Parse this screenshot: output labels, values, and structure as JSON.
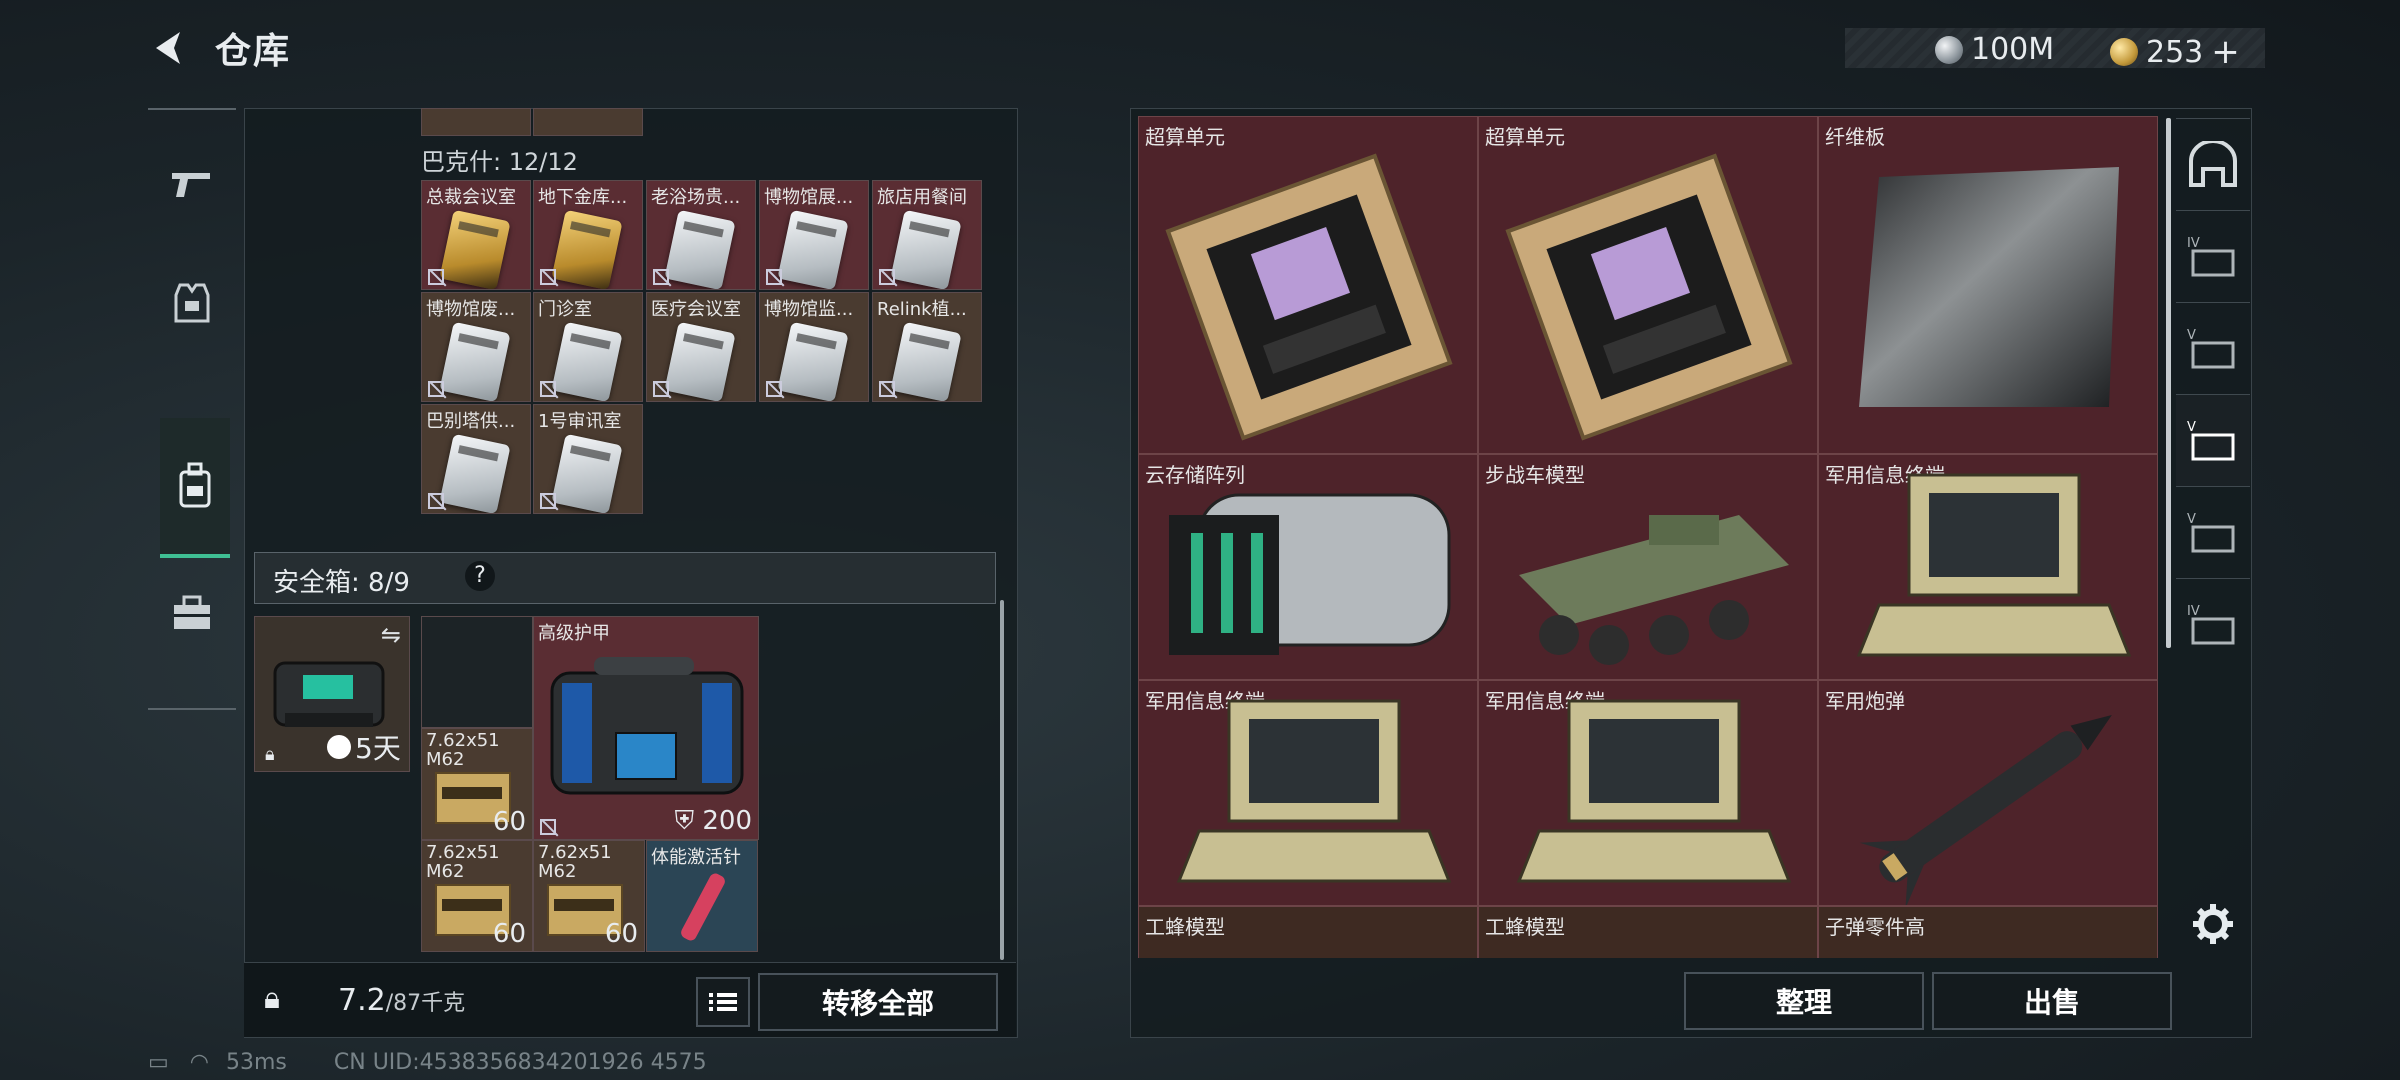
{
  "header": {
    "title": "仓库",
    "silver": "100M",
    "gold": "253",
    "gold_plus": "+"
  },
  "stash": {
    "bucket_label": "巴克什: 12/12",
    "cards": [
      {
        "label": "总裁会议室",
        "kind": "gold"
      },
      {
        "label": "地下金库...",
        "kind": "gold"
      },
      {
        "label": "老浴场贵...",
        "kind": "white"
      },
      {
        "label": "博物馆展...",
        "kind": "white"
      },
      {
        "label": "旅店用餐间",
        "kind": "white"
      },
      {
        "label": "博物馆废...",
        "kind": "white"
      },
      {
        "label": "门诊室",
        "kind": "white"
      },
      {
        "label": "医疗会议室",
        "kind": "white"
      },
      {
        "label": "博物馆监...",
        "kind": "white"
      },
      {
        "label": "Relink植...",
        "kind": "white"
      },
      {
        "label": "巴别塔供...",
        "kind": "white"
      },
      {
        "label": "1号审讯室",
        "kind": "white"
      }
    ]
  },
  "safebox": {
    "label": "安全箱: 8/9",
    "help": "?",
    "time": "5天"
  },
  "items": {
    "armor": {
      "label": "高级护甲",
      "durability": "200"
    },
    "ammo1": {
      "label": "7.62x51 M62",
      "count": "60"
    },
    "ammo2": {
      "label": "7.62x51 M62",
      "count": "60"
    },
    "ammo3": {
      "label": "7.62x51 M62",
      "count": "60"
    },
    "injector": {
      "label": "体能激活针"
    }
  },
  "bottom_left": {
    "weight": "7.2",
    "weight_max": "/87千克",
    "transfer_all": "转移全部"
  },
  "grid": [
    {
      "label": "超算单元",
      "icon": "chip"
    },
    {
      "label": "超算单元",
      "icon": "chip"
    },
    {
      "label": "纤维板",
      "icon": "plate"
    },
    {
      "label": "云存储阵列",
      "icon": "server"
    },
    {
      "label": "步战车模型",
      "icon": "ifv"
    },
    {
      "label": "军用信息终端",
      "icon": "terminal"
    },
    {
      "label": "军用信息终端",
      "icon": "terminal"
    },
    {
      "label": "军用信息终端",
      "icon": "terminal"
    },
    {
      "label": "军用炮弹",
      "icon": "missile"
    },
    {
      "label": "工蜂模型",
      "icon": "drone"
    },
    {
      "label": "工蜂模型",
      "icon": "drone"
    },
    {
      "label": "子弹零件高",
      "icon": "part"
    }
  ],
  "bottom_right": {
    "sort": "整理",
    "sell": "出售"
  },
  "status_bar": {
    "ping": "53ms",
    "uid": "CN UID:4538356834201926 4575"
  }
}
